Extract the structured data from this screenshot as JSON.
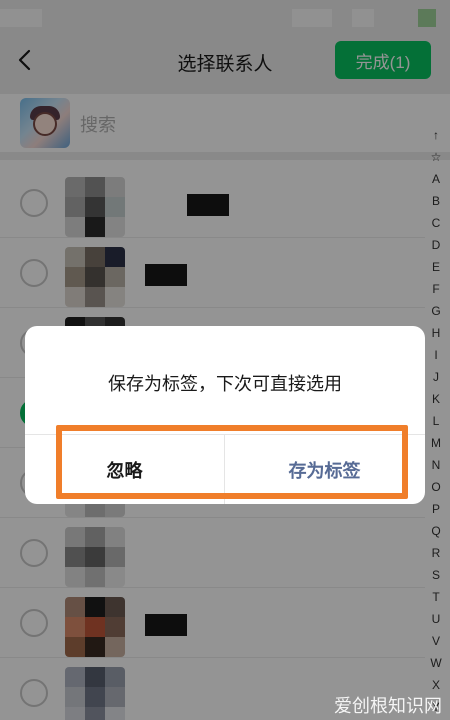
{
  "navbar": {
    "title": "选择联系人",
    "done_label": "完成(1)"
  },
  "search": {
    "placeholder": "搜索"
  },
  "contacts": [
    {
      "checked": false
    },
    {
      "checked": false
    },
    {
      "checked": false
    },
    {
      "checked": true
    },
    {
      "checked": false
    },
    {
      "checked": false
    },
    {
      "checked": false
    },
    {
      "checked": false
    }
  ],
  "alpha_index": [
    "↑",
    "☆",
    "A",
    "B",
    "C",
    "D",
    "E",
    "F",
    "G",
    "H",
    "I",
    "J",
    "K",
    "L",
    "M",
    "N",
    "O",
    "P",
    "Q",
    "R",
    "S",
    "T",
    "U",
    "V",
    "W",
    "X",
    "Y"
  ],
  "dialog": {
    "message": "保存为标签，下次可直接选用",
    "ignore_label": "忽略",
    "save_label": "存为标签"
  },
  "watermark": "爱创根知识网",
  "colors": {
    "accent_green": "#07c160",
    "dialog_link": "#576b95",
    "highlight_orange": "#f07e2a"
  }
}
